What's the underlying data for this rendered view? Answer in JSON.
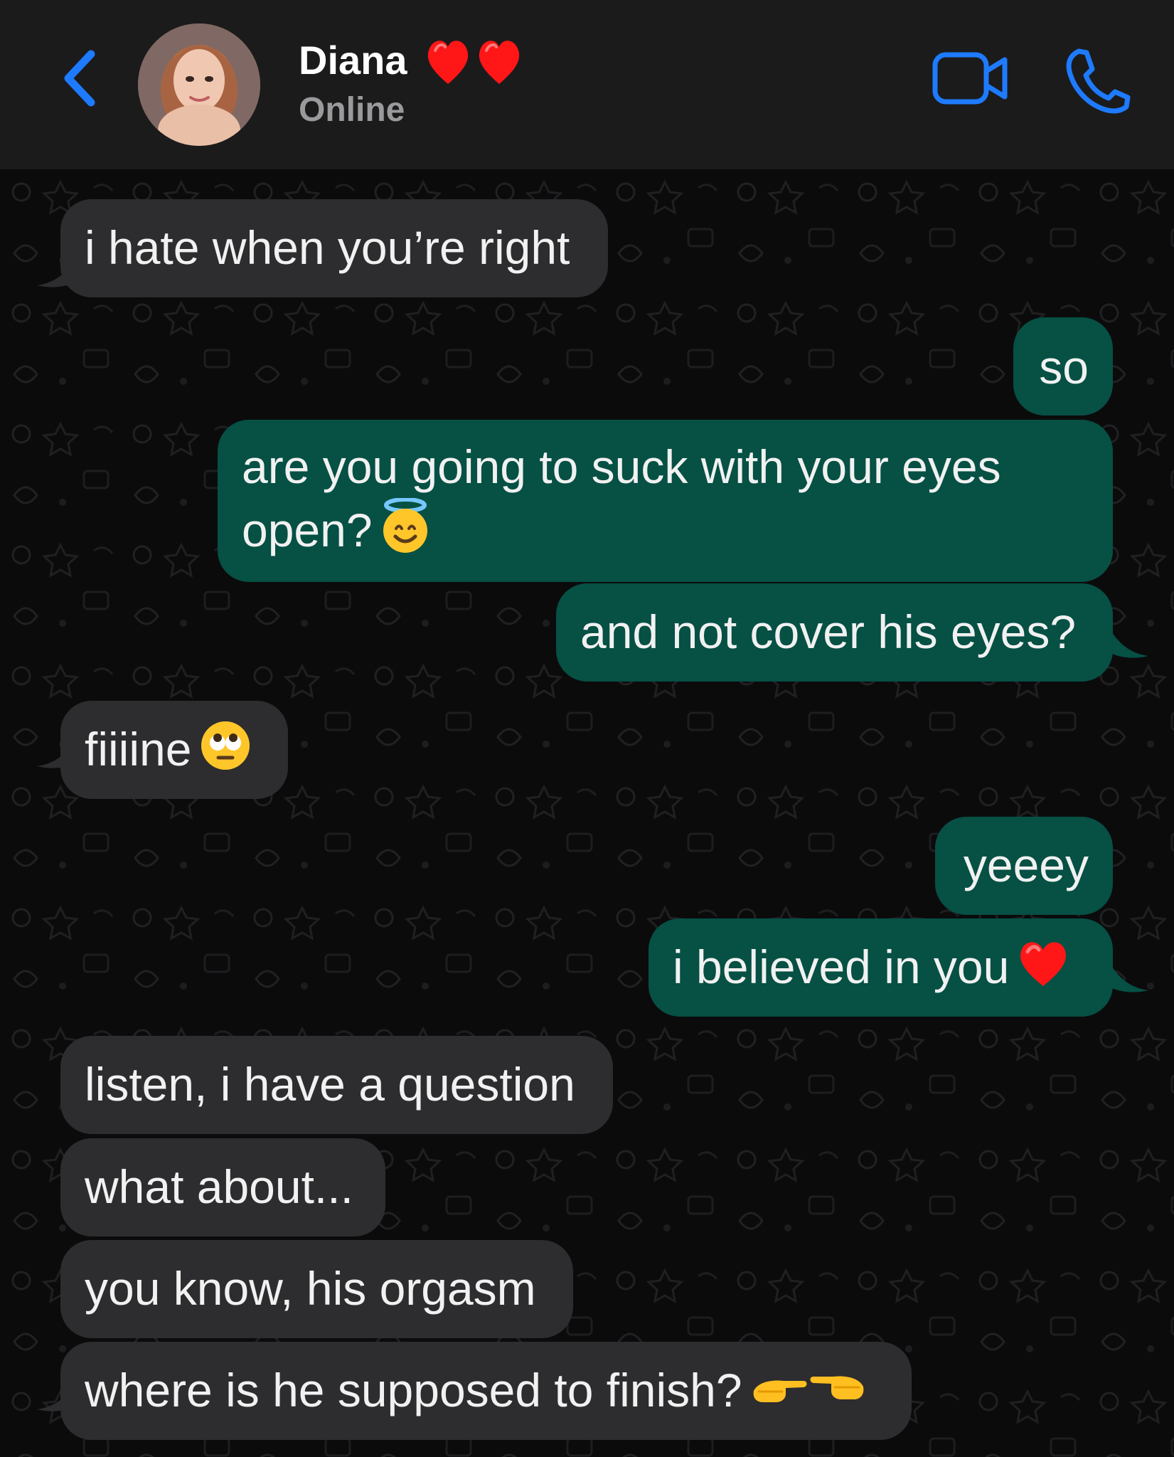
{
  "header": {
    "contact_name": "Diana",
    "name_emojis": "red-heart-emoji red-heart-emoji",
    "status": "Online",
    "accent_color": "#1e7bff",
    "icons": [
      "chevron-left-icon",
      "video-camera-icon",
      "phone-icon"
    ]
  },
  "messages": [
    {
      "direction": "incoming",
      "text": "i hate when you’re right"
    },
    {
      "direction": "outgoing",
      "text": "so"
    },
    {
      "direction": "outgoing",
      "text": "are you going to suck with your eyes open?",
      "emoji": "smiling-face-with-halo-emoji"
    },
    {
      "direction": "outgoing",
      "text": "and not cover his eyes?"
    },
    {
      "direction": "incoming",
      "text": "fiiiine",
      "emoji": "face-with-rolling-eyes-emoji"
    },
    {
      "direction": "outgoing",
      "text": "yeeey"
    },
    {
      "direction": "outgoing",
      "text": "i believed in you",
      "emoji": "red-heart-emoji"
    },
    {
      "direction": "incoming",
      "text": "listen, i have a question"
    },
    {
      "direction": "incoming",
      "text": "what about..."
    },
    {
      "direction": "incoming",
      "text": "you know, his orgasm"
    },
    {
      "direction": "incoming",
      "text": "where is he supposed to finish?",
      "emoji": "pointing-hands-emoji"
    }
  ],
  "colors": {
    "incoming_bubble": "#2d2d2f",
    "outgoing_bubble": "#065044",
    "background": "#0b0b0c",
    "header_background": "#1b1b1c"
  }
}
